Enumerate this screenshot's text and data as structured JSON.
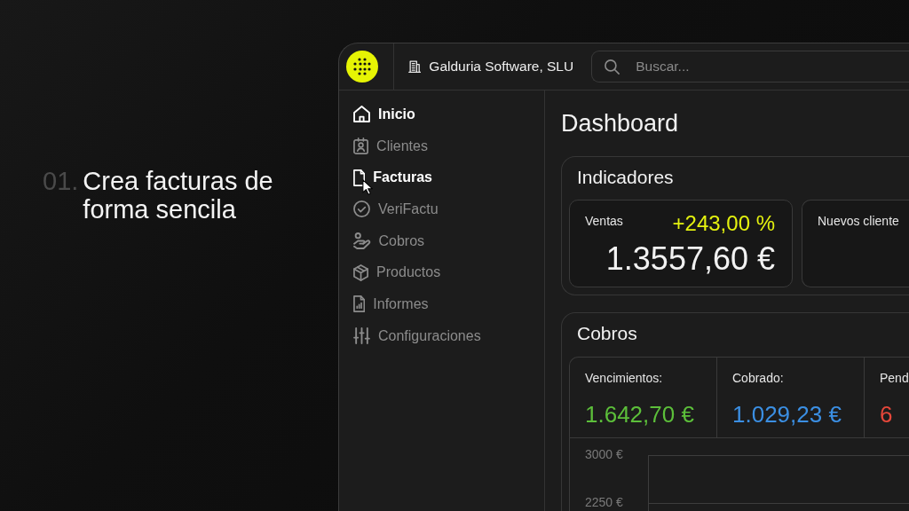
{
  "hero": {
    "number": "01.",
    "title": "Crea facturas de forma sencila"
  },
  "header": {
    "company": "Galduria Software, SLU",
    "search": {
      "placeholder": "Buscar..."
    }
  },
  "sidebar": {
    "items": [
      {
        "label": "Inicio",
        "selected": true,
        "hovered": false
      },
      {
        "label": "Clientes",
        "selected": false,
        "hovered": false
      },
      {
        "label": "Facturas",
        "selected": true,
        "hovered": true
      },
      {
        "label": "VeriFactu",
        "selected": false,
        "hovered": false
      },
      {
        "label": "Cobros",
        "selected": false,
        "hovered": false
      },
      {
        "label": "Productos",
        "selected": false,
        "hovered": false
      },
      {
        "label": "Informes",
        "selected": false,
        "hovered": false
      },
      {
        "label": "Configuraciones",
        "selected": false,
        "hovered": false
      }
    ]
  },
  "page": {
    "title": "Dashboard"
  },
  "indicators": {
    "title": "Indicadores",
    "cards": [
      {
        "label": "Ventas",
        "change": "+243,00 %",
        "value": "1.3557,60 €"
      },
      {
        "label": "Nuevos cliente"
      }
    ]
  },
  "payments": {
    "title": "Cobros",
    "stats": [
      {
        "label": "Vencimientos:",
        "value": "1.642,70 €",
        "color": "#5cbf3a"
      },
      {
        "label": "Cobrado:",
        "value": "1.029,23 €",
        "color": "#3b8fe3"
      },
      {
        "label": "Pend",
        "value": "6",
        "color": "#e5473a"
      }
    ],
    "chart": {
      "y_labels": [
        "3000 €",
        "2250 €"
      ]
    }
  }
}
